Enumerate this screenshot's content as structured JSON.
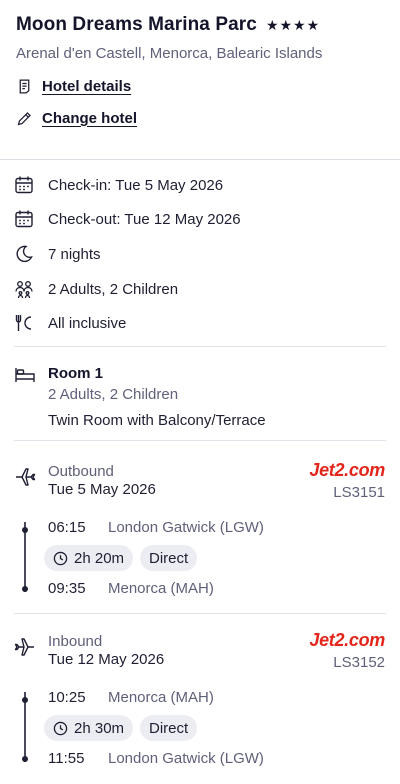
{
  "hotel": {
    "name": "Moon Dreams Marina Parc",
    "stars": "★★★★",
    "location": "Arenal d'en Castell, Menorca, Balearic Islands",
    "details_link": "Hotel details",
    "change_link": "Change hotel"
  },
  "booking": {
    "check_in": "Check-in: Tue 5 May 2026",
    "check_out": "Check-out: Tue 12 May 2026",
    "nights": "7 nights",
    "guests": "2 Adults, 2 Children",
    "board": "All inclusive"
  },
  "room": {
    "title": "Room 1",
    "occupancy": "2 Adults, 2 Children",
    "type": "Twin Room with Balcony/Terrace"
  },
  "outbound": {
    "direction": "Outbound",
    "date": "Tue 5 May 2026",
    "airline": "Jet2.com",
    "flight_number": "LS3151",
    "depart_time": "06:15",
    "depart_airport": "London Gatwick (LGW)",
    "duration": "2h 20m",
    "stops": "Direct",
    "arrive_time": "09:35",
    "arrive_airport": "Menorca (MAH)"
  },
  "inbound": {
    "direction": "Inbound",
    "date": "Tue 12 May 2026",
    "airline": "Jet2.com",
    "flight_number": "LS3152",
    "depart_time": "10:25",
    "depart_airport": "Menorca (MAH)",
    "duration": "2h 30m",
    "stops": "Direct",
    "arrive_time": "11:55",
    "arrive_airport": "London Gatwick (LGW)"
  },
  "colors": {
    "text": "#1f1f33",
    "muted": "#5f607a",
    "airline_brand": "#e2261c",
    "chip_bg": "#ececf3"
  },
  "icons": [
    "document-icon",
    "pencil-icon",
    "calendar-icon",
    "moon-icon",
    "people-icon",
    "cutlery-icon",
    "bed-icon",
    "plane-takeoff-icon",
    "plane-landing-icon",
    "clock-icon"
  ]
}
